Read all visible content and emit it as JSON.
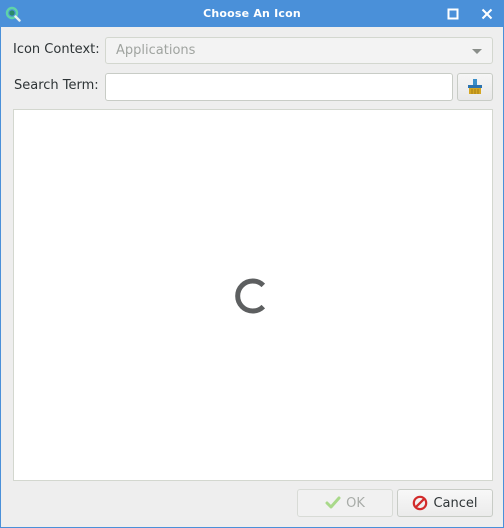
{
  "window": {
    "title": "Choose An Icon",
    "accent_color": "#4a90d9"
  },
  "icon_context": {
    "label": "Icon Context:",
    "selected": "Applications",
    "enabled": false
  },
  "search": {
    "label": "Search Term:",
    "value": "",
    "placeholder": "",
    "clear_icon": "edit-clear-icon"
  },
  "icon_view": {
    "state": "loading",
    "spinner_icon": "spinner-icon"
  },
  "buttons": {
    "ok_label": "OK",
    "ok_enabled": false,
    "cancel_label": "Cancel"
  }
}
